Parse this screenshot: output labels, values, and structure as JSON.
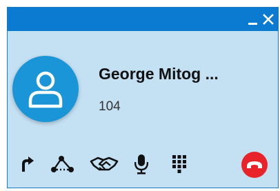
{
  "window": {
    "minimize_icon": "minimize-icon",
    "close_icon": "close-icon"
  },
  "contact": {
    "name": "George Mitog ...",
    "extension": "104",
    "avatar_icon": "user-icon"
  },
  "toolbar": {
    "buttons": [
      {
        "name": "transfer-button",
        "icon": "transfer-arrow-icon"
      },
      {
        "name": "conference-button",
        "icon": "conference-nodes-icon"
      },
      {
        "name": "handshake-button",
        "icon": "handshake-icon"
      },
      {
        "name": "mute-button",
        "icon": "microphone-icon"
      },
      {
        "name": "dialpad-button",
        "icon": "dialpad-icon"
      }
    ],
    "hangup_icon": "hangup-phone-icon"
  },
  "colors": {
    "titlebar": "#0a7bd1",
    "background": "#c4e0f3",
    "avatar": "#1a96d8",
    "hangup": "#e8232a"
  }
}
